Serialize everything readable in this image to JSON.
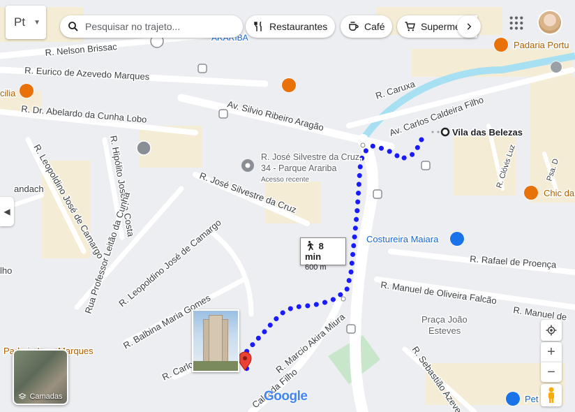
{
  "toolbar": {
    "mode_label": "Pt",
    "search_placeholder": "Pesquisar no trajeto...",
    "chips": [
      {
        "label": "Restaurantes",
        "icon": "utensils-icon"
      },
      {
        "label": "Café",
        "icon": "coffee-cup-icon"
      },
      {
        "label": "Superme",
        "icon": "shopping-cart-icon"
      }
    ]
  },
  "route": {
    "destination": "Vila das Belezas",
    "duration": "8 min",
    "distance": "600 m",
    "mode_icon": "walking-icon",
    "color": "#1a1aff"
  },
  "place": {
    "name_line1": "R. José Silvestre da Cruz,",
    "name_line2": "34 - Parque Arariba",
    "subtitle": "Acesso recente"
  },
  "streets": [
    {
      "name": "R. Nelson Brissac"
    },
    {
      "name": "R. Eurico de Azevedo Marques"
    },
    {
      "name": "R. Dr. Abelardo da Cunha Lobo"
    },
    {
      "name": "Av. Silvio Ribeiro Aragão"
    },
    {
      "name": "R. Caruxa"
    },
    {
      "name": "Av. Carlos Caldeira Filho"
    },
    {
      "name": "R. Leopoldino José de Camargo"
    },
    {
      "name": "R. Hipólito José da Costa"
    },
    {
      "name": "R. José Silvestre da Cruz"
    },
    {
      "name": "Rua Professor Leitão da Cunha"
    },
    {
      "name": "R. Leopoldino José de Camargo"
    },
    {
      "name": "R. Balbina Maria Gomes"
    },
    {
      "name": "R. Carlos"
    },
    {
      "name": "R. Marcio Akira Miura"
    },
    {
      "name": "Calçada Filho"
    },
    {
      "name": "R. Rafael de Proença"
    },
    {
      "name": "R. Manuel de Oliveira Falcão"
    },
    {
      "name": "R. Manuel de"
    },
    {
      "name": "R. Sebastião Azeve"
    },
    {
      "name": "R. Clóvis Luz"
    },
    {
      "name": "Psa. D"
    },
    {
      "name": "andach"
    },
    {
      "name": "lho"
    }
  ],
  "pois": [
    {
      "name": "Padaria Portu",
      "icon": "bakery-icon",
      "color": "#e8710a"
    },
    {
      "name": "Chic da",
      "icon": "bakery-icon",
      "color": "#e8710a"
    },
    {
      "name": "Costureira Maiara",
      "icon": "shopping-bag-icon",
      "color": "#1a73e8"
    },
    {
      "name": "Praça João",
      "name2": "Esteves"
    },
    {
      "name": "Padaria Lora Marques"
    },
    {
      "name": "Pet",
      "icon": "shopping-bag-icon",
      "color": "#1a73e8"
    },
    {
      "name": "cilia",
      "icon": "utensils-icon",
      "color": "#e8710a"
    },
    {
      "name": "ARARIBA"
    }
  ],
  "layers": {
    "label": "Camadas"
  },
  "controls": {
    "zoom_in": "+",
    "zoom_out": "−"
  },
  "branding": {
    "logo": "Google"
  }
}
